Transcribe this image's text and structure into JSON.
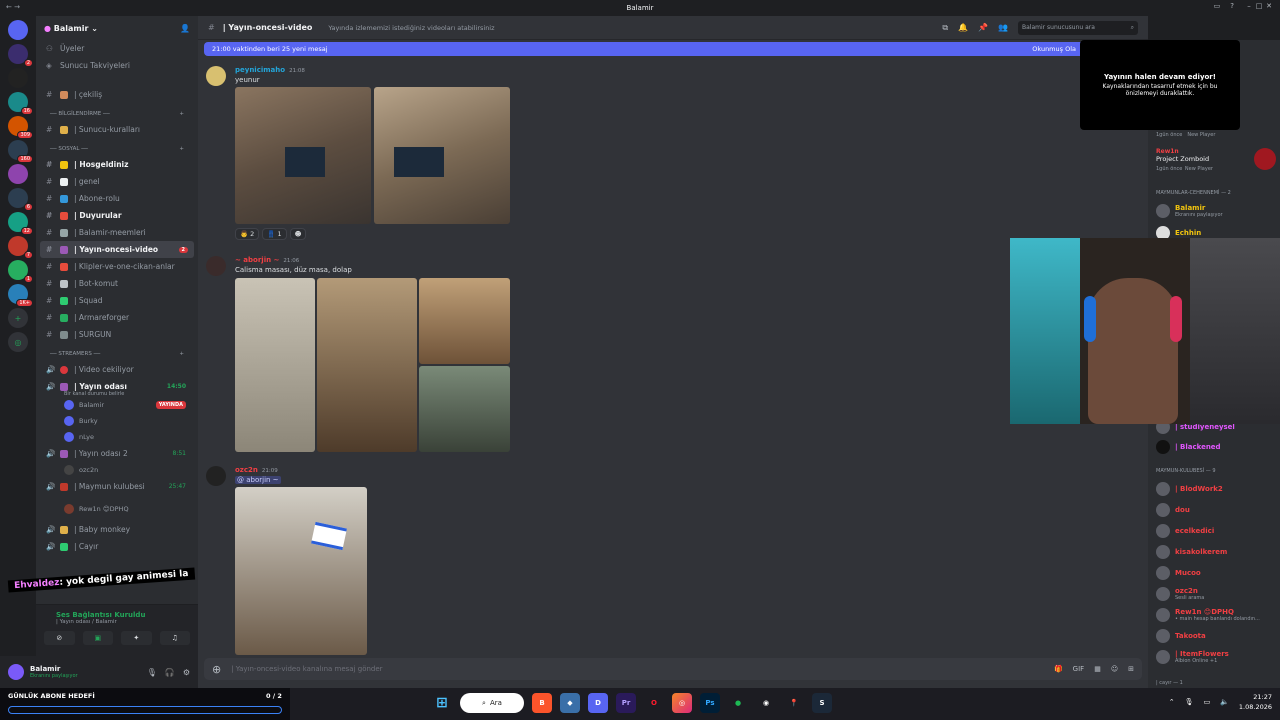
{
  "window": {
    "title": "Balamir"
  },
  "servers": [
    {
      "icon": "discord-icon",
      "badge": ""
    },
    {
      "icon": "server-1",
      "badge": "2"
    },
    {
      "icon": "server-n",
      "badge": ""
    },
    {
      "icon": "server-3",
      "badge": "16"
    },
    {
      "icon": "server-4",
      "badge": "309"
    },
    {
      "icon": "server-5",
      "badge": "160"
    },
    {
      "icon": "server-6",
      "badge": ""
    },
    {
      "icon": "server-7",
      "badge": "6"
    },
    {
      "icon": "server-8",
      "badge": "12"
    },
    {
      "icon": "server-9",
      "badge": "7"
    },
    {
      "icon": "server-10",
      "badge": "1"
    },
    {
      "icon": "server-11",
      "badge": "1K+"
    }
  ],
  "guild": {
    "name": "Balamir"
  },
  "sidebar": {
    "members_label": "Üyeler",
    "boosts_label": "Sunucu Takviyeleri",
    "channels_top": [
      {
        "name": "| çekiliş"
      }
    ],
    "cat_bilgi": "BİLGİLENDİRME",
    "channels_bilgi": [
      {
        "name": "| Sunucu-kuralları"
      }
    ],
    "cat_sosyal": "SOSYAL",
    "channels_sosyal": [
      {
        "name": "| Hosgeldiniz",
        "bold": true,
        "count": ""
      },
      {
        "name": "| genel",
        "bold": false,
        "count": ""
      },
      {
        "name": "| Abone-rolu",
        "bold": false,
        "count": ""
      },
      {
        "name": "| Duyurular",
        "bold": true,
        "count": ""
      },
      {
        "name": "| Balamir-meemleri",
        "bold": false,
        "count": ""
      },
      {
        "name": "| Yayın-oncesi-video",
        "bold": true,
        "count": "2",
        "active": true
      },
      {
        "name": "| Klipler-ve-one-cikan-anlar",
        "bold": false,
        "count": ""
      },
      {
        "name": "| Bot-komut",
        "bold": false,
        "count": ""
      },
      {
        "name": "| Squad",
        "bold": false,
        "count": ""
      },
      {
        "name": "| Armareforger",
        "bold": false,
        "count": ""
      },
      {
        "name": "| SURGUN",
        "bold": false,
        "count": ""
      }
    ],
    "cat_streamers": "STREAMERS",
    "voice": {
      "video_cekiliyor": "| Video cekiliyor",
      "yayin_odasi": "| Yayın odası",
      "yayin_odasi_time": "14:50",
      "yayin_odasi_status": "Bir kanal durumu belirle",
      "yayin_users": [
        {
          "name": "Balamir",
          "live": "YAYINDA"
        },
        {
          "name": "Burky",
          "live": ""
        },
        {
          "name": "nLye",
          "live": ""
        }
      ],
      "yayin_odasi2": "| Yayın odası 2",
      "yayin_odasi2_time": "8:51",
      "yayin2_users": [
        {
          "name": "ozc2n"
        }
      ],
      "maymun": "| Maymun kulubesi",
      "maymun_time": "25:47",
      "maymun_users": [
        {
          "name": "Rew1n 😊DPHQ"
        }
      ],
      "baby": "| Baby monkey",
      "cayir": "| Cayır"
    }
  },
  "overlay_chat": {
    "name": "Ehvaldez",
    "text": ": yok degil gay animesi la"
  },
  "voice_panel": {
    "status": "Ses Bağlantısı Kuruldu",
    "sub": "| Yayın odası / Balamir"
  },
  "user_panel": {
    "name": "Balamir",
    "status": "Ekranını paylaşıyor"
  },
  "header": {
    "channel": "| Yayın-oncesi-video",
    "topic": "Yayında izlememizi istediğiniz videoları atabilirsiniz",
    "search_placeholder": "Balamir sunucusunu ara"
  },
  "banner": {
    "left": "21:00 vaktinden beri 25 yeni mesaj",
    "right": "Okunmuş Ola"
  },
  "messages": [
    {
      "author": "peynicimaho",
      "author_color": "#23a5d9",
      "time": "21:08",
      "text": "yeunur",
      "reactions": [
        "👨 2",
        "👖 1",
        "☻"
      ]
    },
    {
      "author": "~ aborjin ~",
      "author_color": "#f23f43",
      "time": "21:06",
      "text": "Calisma masası, düz masa, dolap"
    },
    {
      "author": "ozc2n",
      "author_color": "#f23f43",
      "time": "21:09",
      "mention": "@ aborjin ~"
    }
  ],
  "composer": {
    "placeholder": "| Yayın-oncesi-video kanalına mesaj gönder"
  },
  "preview": {
    "title": "Yayının halen devam ediyor!",
    "text": "Kaynaklarından tasarruf etmek için bu önizlemeyi duraklattık."
  },
  "members": {
    "activity_top": {
      "time": "1gün önce",
      "tag": "New Player"
    },
    "zomboid": {
      "name": "Rew1n",
      "game": "Project Zomboid",
      "time": "1gün önce",
      "tag": "New Player"
    },
    "cat_cehennem": "MAYMUNLAR-CEHENNEMİ — 2",
    "balamir": {
      "name": "Balamir",
      "sub": "Ekranını paylaşıyor"
    },
    "echhin": {
      "name": "Echhin"
    },
    "studio": {
      "name": "| studiyeneysel"
    },
    "blackened": {
      "name": "| Blackened"
    },
    "cat_kulubesi": "MAYMUN-KULUBESİ — 9",
    "list": [
      {
        "name": "| BlodWork2",
        "color": "#f23f43",
        "sub": ""
      },
      {
        "name": "dou",
        "color": "#f23f43",
        "sub": ""
      },
      {
        "name": "ecelkedici",
        "color": "#f23f43",
        "sub": ""
      },
      {
        "name": "kisakolkerem",
        "color": "#f23f43",
        "sub": ""
      },
      {
        "name": "Mucoo",
        "color": "#f23f43",
        "sub": ""
      },
      {
        "name": "ozc2n",
        "color": "#f23f43",
        "sub": "Sesli arama"
      },
      {
        "name": "Rew1n 😊DPHQ",
        "color": "#f23f43",
        "sub": "• main hesap banlandı dolandın..."
      },
      {
        "name": "Takoota",
        "color": "#f23f43",
        "sub": ""
      },
      {
        "name": "| ItemFlowers",
        "color": "#f23f43",
        "sub": "Albion Online +1"
      }
    ],
    "cat_cayir": "| cayır — 1"
  },
  "subgoal": {
    "label": "GÜNLÜK ABONE HEDEFİ",
    "count": "0 / 2"
  },
  "taskbar": {
    "search": "Ara",
    "time": "21:27",
    "date": "1.08.2026"
  }
}
